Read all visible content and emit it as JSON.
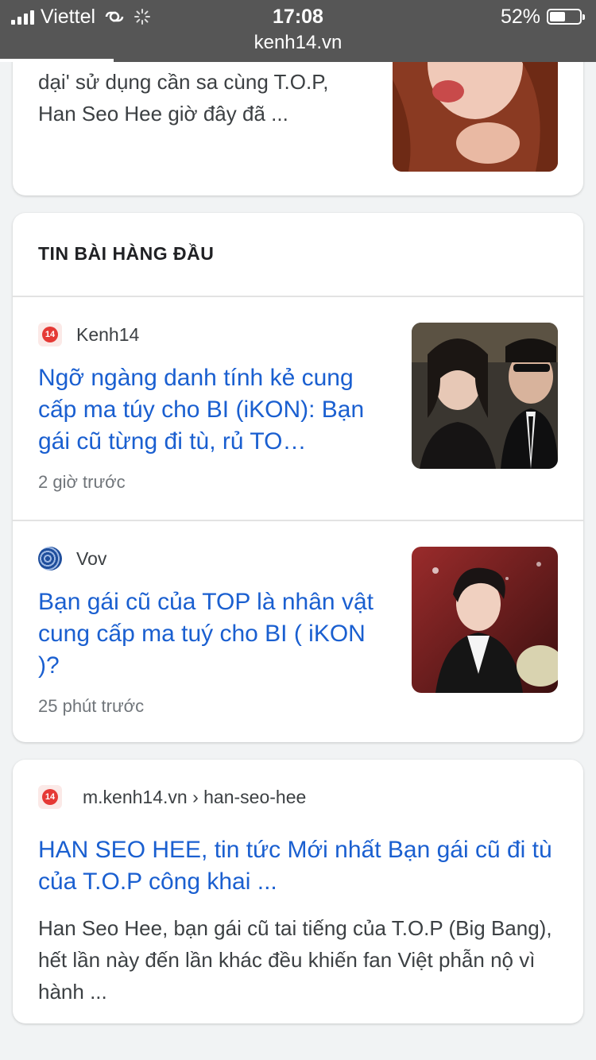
{
  "status_bar": {
    "carrier": "Viettel",
    "time": "17:08",
    "battery": "52%",
    "battery_level": 0.52,
    "url": "kenh14.vn",
    "load_progress": 0.19
  },
  "top_card": {
    "snippet": "dại' sử dụng cần sa cùng T.O.P, Han Seo Hee giờ đây đã ..."
  },
  "top_stories": {
    "title": "TIN BÀI HÀNG ĐẦU",
    "items": [
      {
        "source": "Kenh14",
        "favicon_text": "14",
        "headline": "Ngỡ ngàng danh tính kẻ cung cấp ma túy cho BI (iKON): Bạn gái cũ từng đi tù, rủ TO…",
        "time": "2 giờ trước"
      },
      {
        "source": "Vov",
        "headline": "Bạn gái cũ của TOP là nhân vật cung cấp ma tuý cho BI ( iKON )?",
        "time": "25 phút trước"
      }
    ]
  },
  "result": {
    "favicon_text": "14",
    "url": "m.kenh14.vn › han-seo-hee",
    "title": "HAN SEO HEE, tin tức Mới nhất Bạn gái cũ đi tù của T.O.P công khai ...",
    "description": "Han Seo Hee, bạn gái cũ tai tiếng của T.O.P (Big Bang), hết lần này đến lần khác đều khiến fan Việt phẫn nộ vì hành ..."
  },
  "colors": {
    "link": "#1a5fd0",
    "status_bar": "#565656",
    "background": "#f1f3f4"
  }
}
